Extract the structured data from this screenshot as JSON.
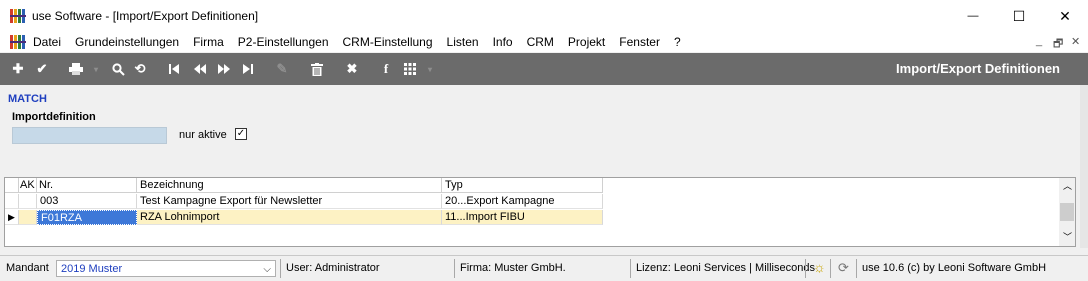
{
  "window": {
    "title": "use Software - [Import/Export Definitionen]",
    "minimize": "—",
    "maximize": "☐",
    "close": "✕"
  },
  "menu": {
    "items": [
      "Datei",
      "Grundeinstellungen",
      "Firma",
      "P2-Einstellungen",
      "CRM-Einstellung",
      "Listen",
      "Info",
      "CRM",
      "Projekt",
      "Fenster",
      "?"
    ],
    "mdi_minimize": "_",
    "mdi_restore": "🗗",
    "mdi_close": "✕"
  },
  "toolbar": {
    "title": "Import/Export Definitionen",
    "icons": [
      "add-icon",
      "save-check-icon",
      "print-icon",
      "search-icon",
      "refresh-icon",
      "first-record-icon",
      "previous-record-icon",
      "next-record-icon",
      "last-record-icon",
      "edit-icon",
      "delete-icon",
      "cancel-icon",
      "facebook-icon",
      "grid-view-icon"
    ]
  },
  "filter": {
    "section": "MATCH",
    "importdefinition_label": "Importdefinition",
    "importdefinition_value": "",
    "nur_aktive_label": "nur aktive",
    "nur_aktive_checked": true
  },
  "grid": {
    "columns": [
      "AK",
      "Nr.",
      "Bezeichnung",
      "Typ"
    ],
    "rows": [
      {
        "ak": "",
        "nr": "003",
        "bezeichnung": "Test Kampagne Export für Newsletter",
        "typ": "20...Export Kampagne",
        "selected": false
      },
      {
        "ak": "",
        "nr": "F01RZA",
        "bezeichnung": "RZA Lohnimport",
        "typ": "11...Import FIBU",
        "selected": true
      }
    ]
  },
  "status": {
    "mandant_label": "Mandant",
    "mandant_value": "2019 Muster",
    "user": "User: Administrator",
    "firma": "Firma: Muster GmbH.",
    "lizenz": "Lizenz: Leoni Services | Milliseconds",
    "version": "use 10.6 (c) by Leoni Software GmbH"
  },
  "colors": {
    "toolbar_bg": "#6b6b6b",
    "section_blue": "#1f3fbf",
    "selected_row": "#fdf2c4",
    "selected_cell": "#3d78d8",
    "input_bg": "#c6d9e8"
  }
}
